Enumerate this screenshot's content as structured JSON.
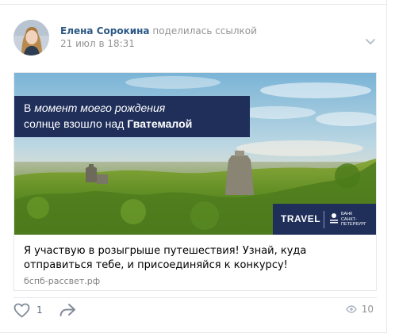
{
  "post": {
    "author_name": "Елена Сорокина",
    "author_action": "поделилась ссылкой",
    "date": "21 июл в 18:31"
  },
  "attachment": {
    "headline_line1_plain": "В ",
    "headline_line1_italic": "момент моего рождения",
    "headline_line2_plain": "солнце взошло над ",
    "headline_line2_bold": "Гватемалой",
    "brand_label": "TRAVEL",
    "bank_name_line1": "БАНК",
    "bank_name_line2": "САНКТ-",
    "bank_name_line3": "ПЕТЕРБУРГ",
    "description": "Я участвую в розыгрыше путешествия! Узнай, куда отправиться тебе, и присоединяйся к конкурсу!",
    "domain": "бспб-рассвет.рф"
  },
  "actions": {
    "like_count": "1",
    "views_count": "10"
  },
  "icons": {
    "menu": "chevron-down-icon",
    "like": "heart-icon",
    "share": "share-arrow-icon",
    "views": "eye-icon",
    "bank": "bank-logo-icon"
  },
  "colors": {
    "link": "#2a5885",
    "muted": "#939393",
    "banner_navy": "#1f2f5a",
    "action_icon": "#828a99"
  }
}
